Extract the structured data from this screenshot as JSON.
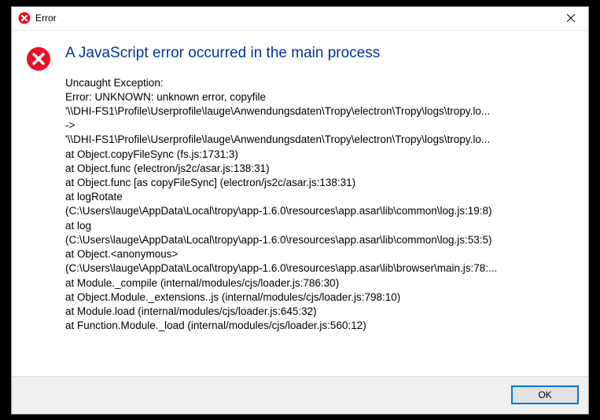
{
  "titlebar": {
    "title": "Error"
  },
  "dialog": {
    "heading": "A JavaScript error occurred in the main process",
    "body_lines": [
      "Uncaught Exception:",
      "Error: UNKNOWN: unknown error, copyfile",
      "'\\\\DHI-FS1\\Profile\\Userprofile\\lauge\\Anwendungsdaten\\Tropy\\electron\\Tropy\\logs\\tropy.lo...",
      "->",
      "'\\\\DHI-FS1\\Profile\\Userprofile\\lauge\\Anwendungsdaten\\Tropy\\electron\\Tropy\\logs\\tropy.lo...",
      "    at Object.copyFileSync (fs.js:1731:3)",
      "    at Object.func (electron/js2c/asar.js:138:31)",
      "    at Object.func [as copyFileSync] (electron/js2c/asar.js:138:31)",
      "    at logRotate",
      "(C:\\Users\\lauge\\AppData\\Local\\tropy\\app-1.6.0\\resources\\app.asar\\lib\\common\\log.js:19:8)",
      "    at log",
      "(C:\\Users\\lauge\\AppData\\Local\\tropy\\app-1.6.0\\resources\\app.asar\\lib\\common\\log.js:53:5)",
      "    at Object.<anonymous>",
      "(C:\\Users\\lauge\\AppData\\Local\\tropy\\app-1.6.0\\resources\\app.asar\\lib\\browser\\main.js:78:...",
      "    at Module._compile (internal/modules/cjs/loader.js:786:30)",
      "    at Object.Module._extensions..js (internal/modules/cjs/loader.js:798:10)",
      "    at Module.load (internal/modules/cjs/loader.js:645:32)",
      "    at Function.Module._load (internal/modules/cjs/loader.js:560:12)"
    ],
    "ok_label": "OK"
  },
  "colors": {
    "error_red": "#e81123",
    "heading_blue": "#003399",
    "focus_blue": "#0078d7"
  }
}
